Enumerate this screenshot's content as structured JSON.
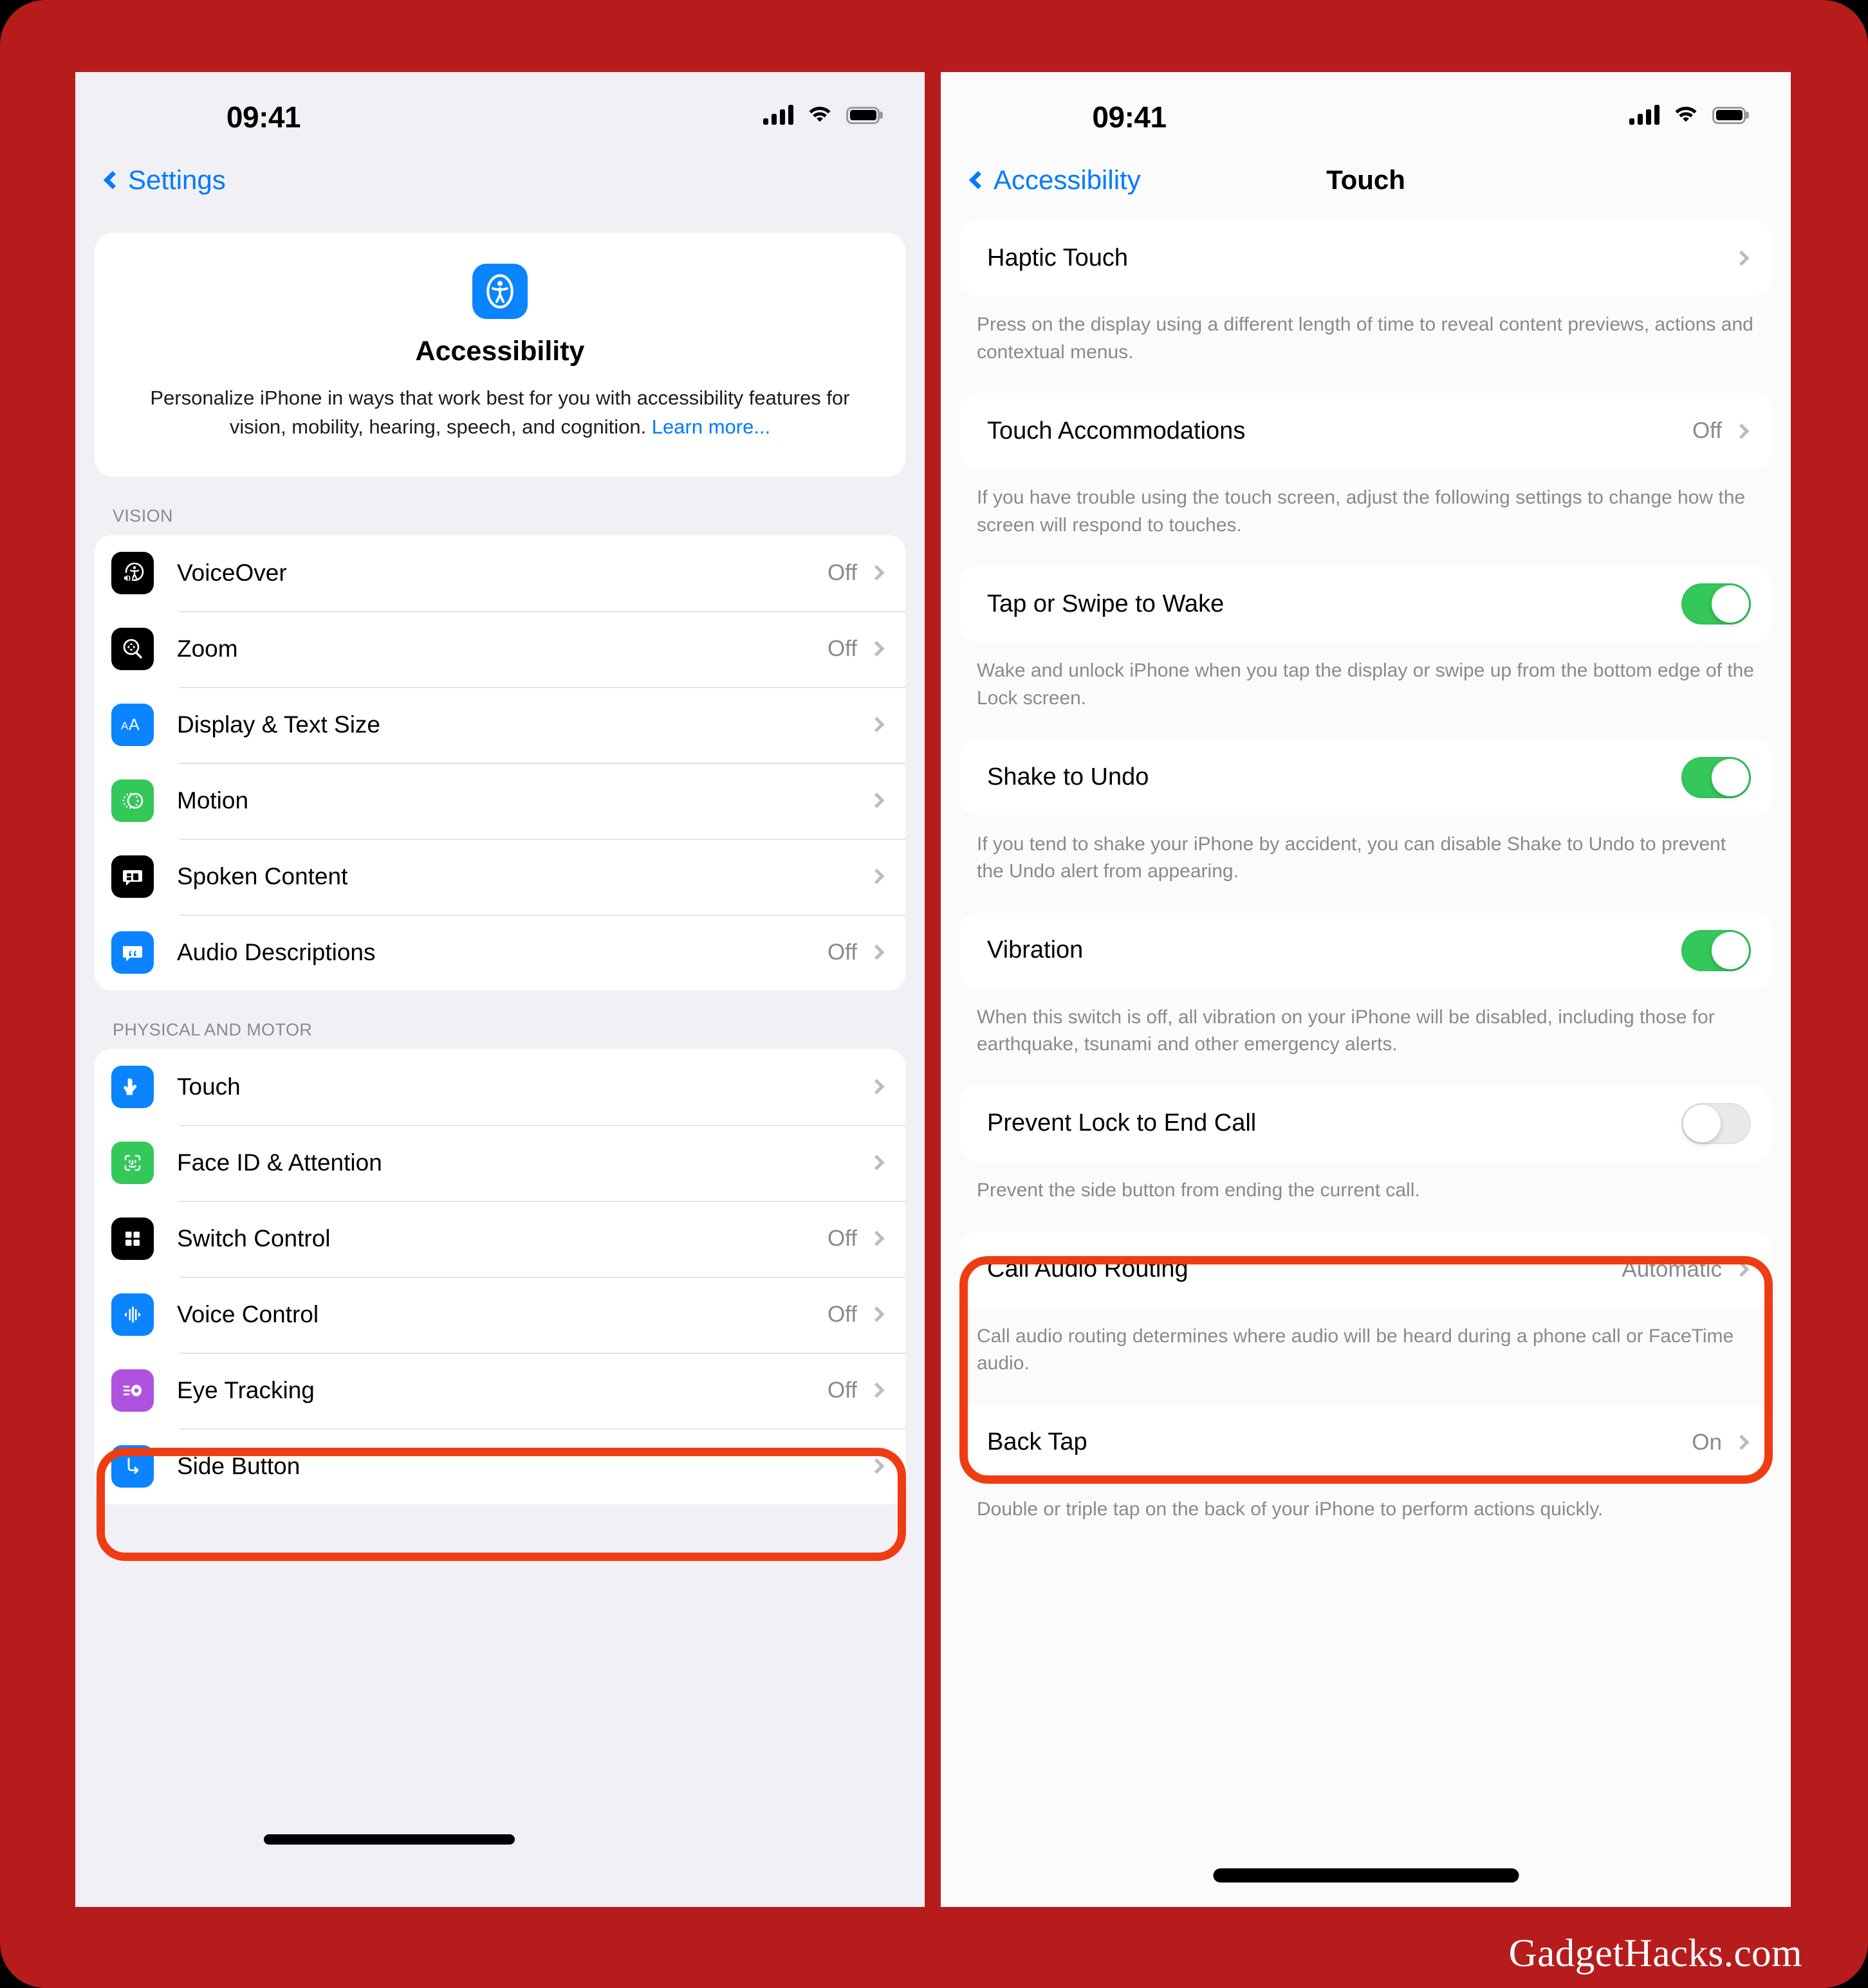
{
  "watermark": "GadgetHacks.com",
  "colors": {
    "background_red": "#b71c1c",
    "highlight_ring": "#f03c13",
    "accent_blue": "#007aff",
    "toggle_on_green": "#34c759",
    "panel_gray": "#f1f1f5"
  },
  "left_panel": {
    "status": {
      "time": "09:41",
      "signal": "cellular-bars-icon",
      "wifi": "wifi-icon",
      "battery": "battery-full-icon"
    },
    "nav": {
      "back_label": "Settings",
      "title": ""
    },
    "hero": {
      "icon": "accessibility-icon",
      "title": "Accessibility",
      "description": "Personalize iPhone in ways that work best for you with accessibility features for vision, mobility, hearing, speech, and cognition. ",
      "link_label": "Learn more..."
    },
    "sections": [
      {
        "header": "VISION",
        "items": [
          {
            "label": "VoiceOver",
            "value": "Off",
            "icon": "voiceover-icon",
            "icon_bg": "#000000",
            "chevron": true
          },
          {
            "label": "Zoom",
            "value": "Off",
            "icon": "zoom-magnifier-icon",
            "icon_bg": "#000000",
            "chevron": true
          },
          {
            "label": "Display & Text Size",
            "value": "",
            "icon": "text-size-icon",
            "icon_bg": "#0a84ff",
            "chevron": true
          },
          {
            "label": "Motion",
            "value": "",
            "icon": "motion-icon",
            "icon_bg": "#34c759",
            "chevron": true
          },
          {
            "label": "Spoken Content",
            "value": "",
            "icon": "spoken-content-icon",
            "icon_bg": "#000000",
            "chevron": true
          },
          {
            "label": "Audio Descriptions",
            "value": "Off",
            "icon": "audio-descriptions-icon",
            "icon_bg": "#0a84ff",
            "chevron": true
          }
        ]
      },
      {
        "header": "PHYSICAL AND MOTOR",
        "items": [
          {
            "label": "Touch",
            "value": "",
            "icon": "touch-hand-icon",
            "icon_bg": "#0a84ff",
            "chevron": true,
            "highlighted": true
          },
          {
            "label": "Face ID & Attention",
            "value": "",
            "icon": "face-id-icon",
            "icon_bg": "#34c759",
            "chevron": true
          },
          {
            "label": "Switch Control",
            "value": "Off",
            "icon": "switch-control-icon",
            "icon_bg": "#000000",
            "chevron": true
          },
          {
            "label": "Voice Control",
            "value": "Off",
            "icon": "voice-control-icon",
            "icon_bg": "#0a84ff",
            "chevron": true
          },
          {
            "label": "Eye Tracking",
            "value": "Off",
            "icon": "eye-tracking-icon",
            "icon_bg": "#af52de",
            "chevron": true
          },
          {
            "label": "Side Button",
            "value": "",
            "icon": "side-button-icon",
            "icon_bg": "#0a84ff",
            "chevron": true
          }
        ]
      }
    ]
  },
  "right_panel": {
    "status": {
      "time": "09:41",
      "signal": "cellular-bars-icon",
      "wifi": "wifi-icon",
      "battery": "battery-full-icon"
    },
    "nav": {
      "back_label": "Accessibility",
      "title": "Touch"
    },
    "groups": [
      {
        "rows": [
          {
            "label": "Haptic Touch",
            "type": "chevron",
            "value": ""
          }
        ],
        "footnote": "Press on the display using a different length of time to reveal content previews, actions and contextual menus."
      },
      {
        "rows": [
          {
            "label": "Touch Accommodations",
            "type": "chevron",
            "value": "Off"
          }
        ],
        "footnote": "If you have trouble using the touch screen, adjust the following settings to change how the screen will respond to touches."
      },
      {
        "rows": [
          {
            "label": "Tap or Swipe to Wake",
            "type": "toggle",
            "toggle_state": "on"
          }
        ],
        "footnote": "Wake and unlock iPhone when you tap the display or swipe up from the bottom edge of the Lock screen."
      },
      {
        "rows": [
          {
            "label": "Shake to Undo",
            "type": "toggle",
            "toggle_state": "on"
          }
        ],
        "footnote": "If you tend to shake your iPhone by accident, you can disable Shake to Undo to prevent the Undo alert from appearing."
      },
      {
        "highlighted": true,
        "rows": [
          {
            "label": "Vibration",
            "type": "toggle",
            "toggle_state": "on"
          }
        ],
        "footnote": "When this switch is off, all vibration on your iPhone will be disabled, including those for earthquake, tsunami and other emergency alerts."
      },
      {
        "rows": [
          {
            "label": "Prevent Lock to End Call",
            "type": "toggle",
            "toggle_state": "off"
          }
        ],
        "footnote": "Prevent the side button from ending the current call."
      },
      {
        "rows": [
          {
            "label": "Call Audio Routing",
            "type": "chevron",
            "value": "Automatic"
          }
        ],
        "footnote": "Call audio routing determines where audio will be heard during a phone call or FaceTime audio."
      },
      {
        "rows": [
          {
            "label": "Back Tap",
            "type": "chevron",
            "value": "On"
          }
        ],
        "footnote": "Double or triple tap on the back of your iPhone to perform actions quickly."
      }
    ]
  }
}
